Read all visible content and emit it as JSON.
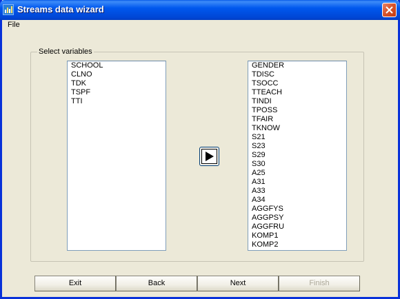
{
  "window": {
    "title": "Streams data wizard"
  },
  "menu": {
    "file_label": "File"
  },
  "group": {
    "label": "Select variables"
  },
  "left_list": {
    "items": [
      "SCHOOL",
      "CLNO",
      "TDK",
      "TSPF",
      "TTI"
    ]
  },
  "right_list": {
    "items": [
      "GENDER",
      "TDISC",
      "TSOCC",
      "TTEACH",
      "TINDI",
      "TPOSS",
      "TFAIR",
      "TKNOW",
      "S21",
      "S23",
      "S29",
      "S30",
      "A25",
      "A31",
      "A33",
      "A34",
      "AGGFYS",
      "AGGPSY",
      "AGGFRU",
      "KOMP1",
      "KOMP2"
    ]
  },
  "buttons": {
    "exit": "Exit",
    "back": "Back",
    "next": "Next",
    "finish": "Finish"
  },
  "colors": {
    "titlebar": "#0058ee",
    "window_bg": "#ece9d8",
    "close": "#d8562e",
    "disabled_text": "#aca899"
  },
  "icons": {
    "app": "chart-icon",
    "close": "close-icon",
    "move": "play-arrow-icon"
  }
}
